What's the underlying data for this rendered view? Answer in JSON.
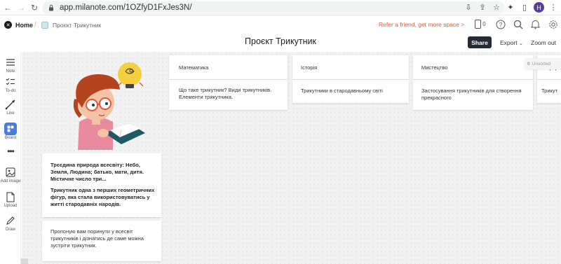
{
  "browser": {
    "url": "app.milanote.com/1OZfyD1FxJes3N/",
    "avatar_letter": "H"
  },
  "header": {
    "home_label": "Home",
    "breadcrumb_board": "Проєкт Трикутник",
    "referral_text": "Refer a friend, get more space >",
    "device_count": "0",
    "page_title": "Проєкт Трикутник",
    "share_label": "Share",
    "export_label": "Export",
    "zoom_label": "Zoom out"
  },
  "toolbar": {
    "items": [
      {
        "label": "Note",
        "icon": "note-icon"
      },
      {
        "label": "To-do",
        "icon": "todo-icon"
      },
      {
        "label": "Line",
        "icon": "line-icon"
      },
      {
        "label": "Board",
        "icon": "board-icon"
      },
      {
        "label": "",
        "icon": "more-icon"
      },
      {
        "label": "Add image",
        "icon": "image-icon"
      },
      {
        "label": "Upload",
        "icon": "upload-icon"
      },
      {
        "label": "Draw",
        "icon": "pencil-icon"
      }
    ]
  },
  "columns": [
    {
      "title": "Математика",
      "body": "Що таке трикутник? Види трикутників. Елементи трикутника."
    },
    {
      "title": "Історія",
      "body": "Трикутники в стародавньому світі"
    },
    {
      "title": "Мистецтво",
      "body": "Застосування трикутників для створення прекрасного"
    },
    {
      "title": "Природа",
      "body": "Трикут"
    }
  ],
  "unsorted": {
    "count": "0",
    "label": "Unsorted"
  },
  "notes": [
    {
      "para1": "Трєєдина природа всесвіту: Небо, Земля, Людина; батько, мати, дитя. Містичне число три...",
      "para2": "Трикутник одна з перших геометричних фігур, яка стала використовуватись у житті стародавніх народів."
    },
    {
      "para1": "Пропоную вам поринути у всесвіт трикутників і дізнатись де саме можна зустріти трикутник."
    }
  ],
  "colors": {
    "accent_orange": "#e2573b",
    "share_bg": "#262b33",
    "board_blue": "#4a7bd8"
  }
}
